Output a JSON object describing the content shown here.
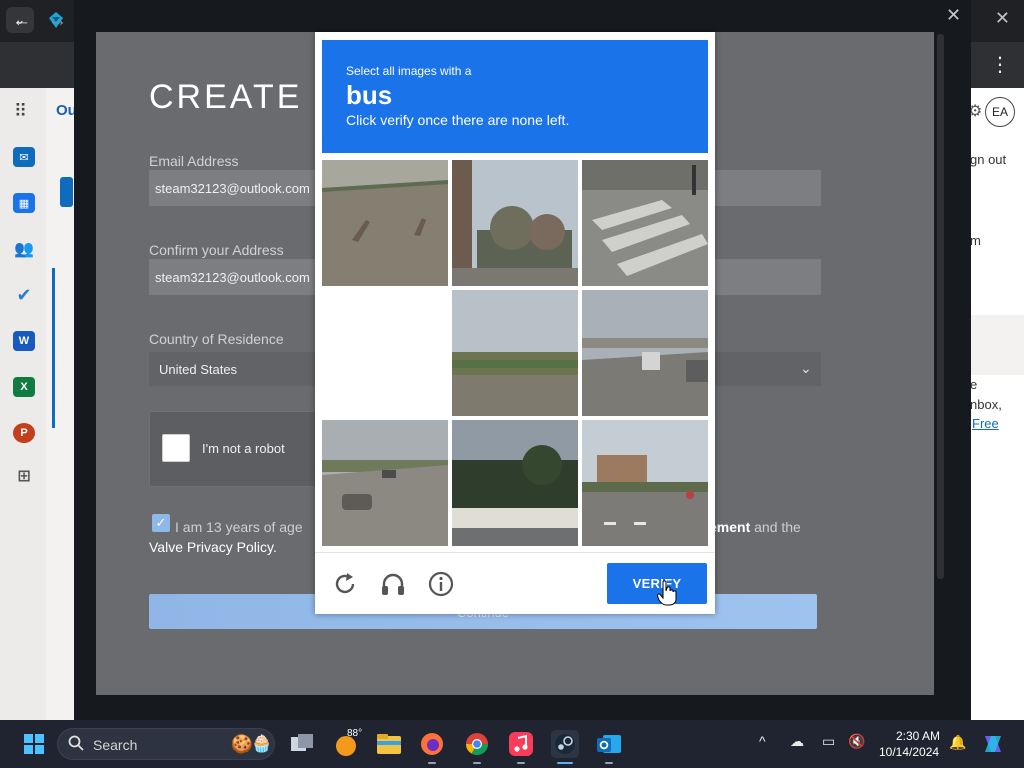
{
  "browser": {
    "menu_chevron": "⌄",
    "back": "←",
    "forward": "→",
    "kebab": "⋮",
    "close": "✕"
  },
  "outlook": {
    "app_label": "Ou",
    "avatar_initials": "EA",
    "right_texts": [
      "gn out",
      "m",
      "e",
      "nbox,"
    ],
    "right_link": "Free"
  },
  "steam": {
    "close": "✕",
    "title": "CREATE Y",
    "email_label": "Email Address",
    "email_value": "steam32123@outlook.com",
    "confirm_label": "Confirm your Address",
    "confirm_value": "steam32123@outlook.com",
    "country_label": "Country of Residence",
    "country_value": "United States",
    "recaptcha_label": "I'm not a robot",
    "age_text": "I am 13 years of age",
    "agreement_bold": "ement",
    "agreement_rest": " and the",
    "privacy_text": "Valve Privacy Policy.",
    "continue_label": "Continue"
  },
  "captcha": {
    "instruction_small": "Select all images with a",
    "target_word": "bus",
    "instruction_sub": "Click verify once there are none left.",
    "verify_label": "VERIFY",
    "tiles": [
      "road-tile",
      "trees-street-tile",
      "crosswalk-tile",
      "blank-tile",
      "field-road-tile",
      "bus-highway-tile",
      "cars-highway-tile",
      "building-trees-tile",
      "intersection-tile"
    ]
  },
  "taskbar": {
    "search_label": "Search",
    "weather_temp": "88°",
    "clock_time": "2:30 AM",
    "clock_date": "10/14/2024"
  },
  "colors": {
    "captcha_blue": "#1a73e8",
    "steam_overlay": "#6a6b6f",
    "taskbar": "#1f2430"
  }
}
